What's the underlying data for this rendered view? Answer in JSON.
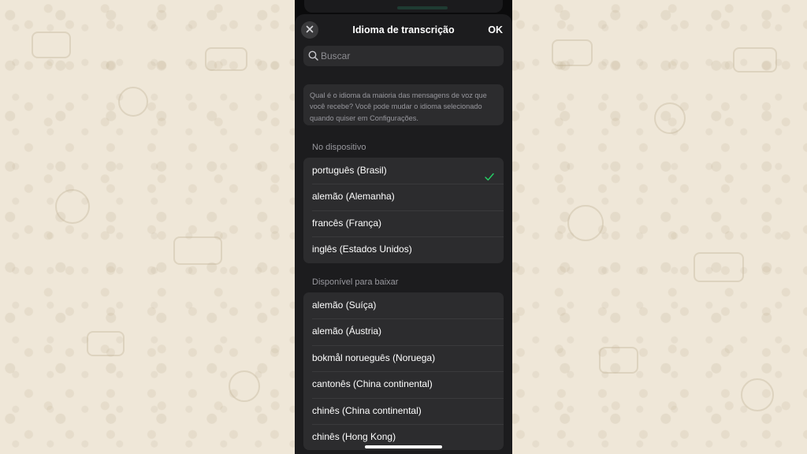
{
  "header": {
    "title": "Idioma de transcrição",
    "ok_label": "OK",
    "close_icon": "close-icon"
  },
  "search": {
    "placeholder": "Buscar",
    "value": ""
  },
  "info_text": "Qual é o idioma da maioria das mensagens de voz que você recebe? Você pode mudar o idioma selecionado quando quiser em Configurações.",
  "on_device": {
    "label": "No dispositivo",
    "items": [
      {
        "label": "português (Brasil)",
        "selected": true
      },
      {
        "label": "alemão (Alemanha)",
        "selected": false
      },
      {
        "label": "francês (França)",
        "selected": false
      },
      {
        "label": "inglês (Estados Unidos)",
        "selected": false
      }
    ]
  },
  "downloadable": {
    "label": "Disponível para baixar",
    "items": [
      {
        "label": "alemão (Suíça)"
      },
      {
        "label": "alemão (Áustria)"
      },
      {
        "label": "bokmål norueguês (Noruega)"
      },
      {
        "label": "cantonês (China continental)"
      },
      {
        "label": "chinês (China continental)"
      },
      {
        "label": "chinês (Hong Kong)"
      }
    ]
  },
  "colors": {
    "accent": "#25d366",
    "sheet_bg": "#1c1c1e",
    "cell_bg": "#2c2c2e",
    "wallpaper": "#efe7d8"
  }
}
